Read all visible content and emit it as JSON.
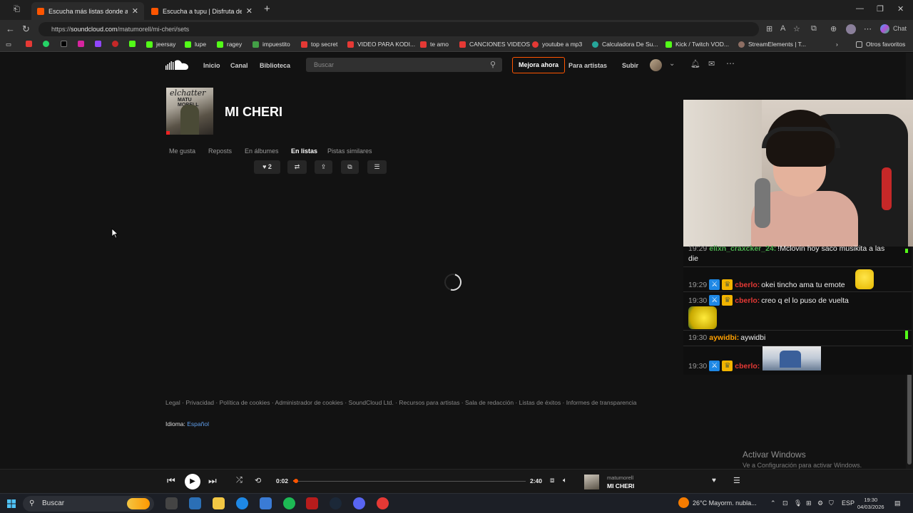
{
  "browser": {
    "tabs": [
      {
        "label": "Escucha más listas donde aparece",
        "active": true
      },
      {
        "label": "Escucha a tupu | Disfruta de la list",
        "active": false
      }
    ],
    "url_prefix": "https://",
    "url_host": "soundcloud.com",
    "url_path": "/matumorell/mi-cheri/sets",
    "chat_label": "Chat",
    "bookmarks": [
      "",
      "",
      "",
      "",
      "",
      "",
      "",
      "jeersay",
      "lupe",
      "ragey",
      "impuestito",
      "top secret",
      "VIDEO PARA KODI...",
      "te amo",
      "CANCIONES VIDEOS",
      "youtube a mp3",
      "Calculadora De Su...",
      "Kick / Twitch VOD...",
      "StreamElements | T...",
      "Otros favoritos"
    ]
  },
  "soundcloud": {
    "nav": {
      "home": "Inicio",
      "feed": "Canal",
      "library": "Biblioteca",
      "search_placeholder": "Buscar",
      "upgrade": "Mejora ahora",
      "for_artists": "Para artistas",
      "upload": "Subir"
    },
    "cover_text": "elchatter",
    "cover_sub": "MATU MORELL",
    "track_title": "MI CHERI",
    "subtabs": [
      "Me gusta",
      "Reposts",
      "En álbumes",
      "En listas",
      "Pistas similares"
    ],
    "selected_subtab": "En listas",
    "like_count": "2",
    "footer_links": "Legal · Privacidad · Política de cookies · Administrador de cookies · SoundCloud Ltd. · Recursos para artistas · Sala de redacción · Listas de éxitos · Informes de transparencia",
    "language_label": "Idioma:",
    "language_value": "Español"
  },
  "windows_watermark": {
    "line1": "Activar Windows",
    "line2": "Ve a Configuración para activar Windows."
  },
  "chat": {
    "messages": [
      {
        "time": "19:29",
        "user": "elixn_craxcker_24:",
        "user_color": "#4caf50",
        "text": "!Mclovin hoy saco musikita a las",
        "text2": "die"
      },
      {
        "time": "19:29",
        "user": "cberlo:",
        "user_color": "#e53935",
        "text": "okei tincho ama tu emote"
      },
      {
        "time": "19:30",
        "user": "cberlo:",
        "user_color": "#e53935",
        "text": "creo q el lo puso de vuelta"
      },
      {
        "time": "19:30",
        "user": "aywidbi:",
        "user_color": "#ffa000",
        "text": "aywidbi"
      },
      {
        "time": "19:30",
        "user": "cberlo:",
        "user_color": "#e53935",
        "text": ""
      }
    ]
  },
  "player": {
    "elapsed": "0:02",
    "duration": "2:40",
    "progress": 0.0125,
    "artist": "matumorell",
    "title": "MI CHERI"
  },
  "taskbar": {
    "search_label": "Buscar",
    "weather": "26°C  Mayorm. nubla...",
    "language": "ESP",
    "time": "19:30",
    "date": "04/03/2026"
  }
}
